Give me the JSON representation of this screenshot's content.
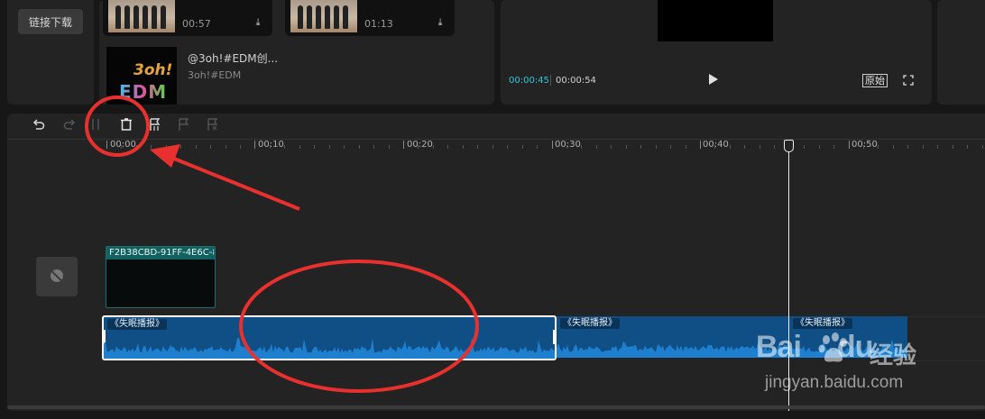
{
  "sidebar": {
    "link_download": "链接下载"
  },
  "media": {
    "items": [
      {
        "duration": "00:57"
      },
      {
        "duration": "01:13"
      }
    ],
    "music_item": {
      "thumb_line1": "3oh!",
      "thumb_line2": "EDM",
      "title": "@3oh!#EDM创...",
      "artist": "3oh!#EDM"
    }
  },
  "player": {
    "current_time": "00:00:45",
    "total_time": "00:00:54",
    "original_label": "原始"
  },
  "timeline": {
    "ruler_labels": [
      "00:00",
      "00:10",
      "00:20",
      "00:30",
      "00:40",
      "00:50"
    ],
    "video_clip_name": "F2B38CBD-91FF-4E6C-8",
    "audio_clips": [
      {
        "label": "《失眠播报》"
      },
      {
        "label": "《失眠播报》"
      },
      {
        "label": "《失眠播报》"
      }
    ]
  },
  "watermark": {
    "brand": "Bai",
    "brand2": "du",
    "text": "经验",
    "url": "jingyan.baidu.com"
  },
  "colors": {
    "accent_cyan": "#33c7d6",
    "audio_clip": "#0f4f86",
    "video_clip_header": "#106160",
    "annotation_red": "#e8312f"
  }
}
